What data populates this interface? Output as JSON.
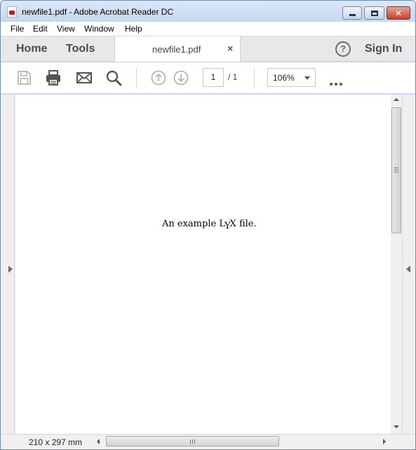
{
  "window": {
    "title": "newfile1.pdf - Adobe Acrobat Reader DC",
    "minimize_glyph": "",
    "maximize_glyph": "",
    "close_glyph": "✕"
  },
  "menu": {
    "items": [
      {
        "label": "File"
      },
      {
        "label": "Edit"
      },
      {
        "label": "View"
      },
      {
        "label": "Window"
      },
      {
        "label": "Help"
      }
    ]
  },
  "tabs": {
    "home": "Home",
    "tools": "Tools",
    "document": "newfile1.pdf",
    "close_glyph": "×",
    "help_glyph": "?",
    "sign_in": "Sign In"
  },
  "toolbar": {
    "icons": [
      "save-icon",
      "print-icon",
      "email-icon",
      "search-icon",
      "previous-page-icon",
      "next-page-icon",
      "more-options-icon"
    ],
    "current_page": "1",
    "page_total": "/ 1",
    "zoom": "106%"
  },
  "document": {
    "text_before": "An example ",
    "lyx_l": "L",
    "lyx_y": "Y",
    "lyx_x": "X",
    "text_after": " file."
  },
  "status": {
    "page_size": "210 x 297 mm"
  },
  "colors": {
    "page": "#ffffff",
    "background": "#e9e9e9",
    "title_bar": "#c9d9ee",
    "close_button": "#c5432c"
  }
}
